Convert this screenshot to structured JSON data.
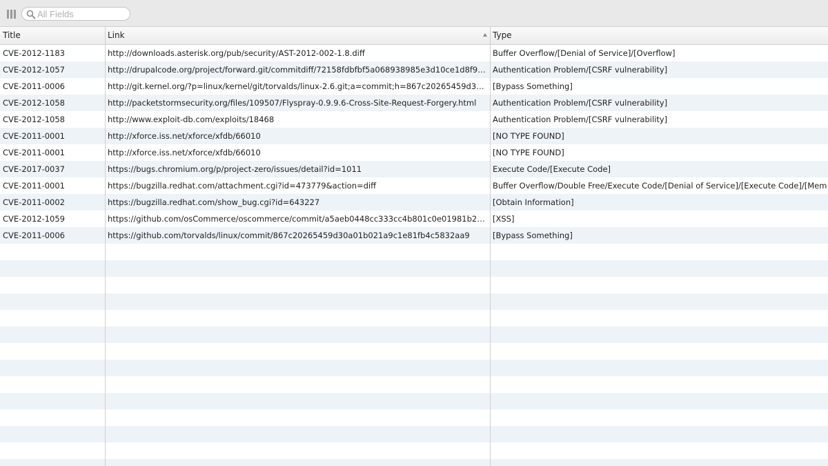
{
  "search": {
    "placeholder": "All Fields",
    "value": ""
  },
  "columns": {
    "title": "Title",
    "link": "Link",
    "type": "Type"
  },
  "rows": [
    {
      "title": "CVE-2012-1183",
      "link": "http://downloads.asterisk.org/pub/security/AST-2012-002-1.8.diff",
      "type": "Buffer Overflow/[Denial of Service]/[Overflow]"
    },
    {
      "title": "CVE-2012-1057",
      "link": "http://drupalcode.org/project/forward.git/commitdiff/72158fdbfbf5a068938985e3d10ce1d8f96...",
      "type": "Authentication Problem/[CSRF vulnerability]"
    },
    {
      "title": "CVE-2011-0006",
      "link": "http://git.kernel.org/?p=linux/kernel/git/torvalds/linux-2.6.git;a=commit;h=867c20265459d30...",
      "type": "[Bypass Something]"
    },
    {
      "title": "CVE-2012-1058",
      "link": "http://packetstormsecurity.org/files/109507/Flyspray-0.9.9.6-Cross-Site-Request-Forgery.html",
      "type": "Authentication Problem/[CSRF vulnerability]"
    },
    {
      "title": "CVE-2012-1058",
      "link": "http://www.exploit-db.com/exploits/18468",
      "type": "Authentication Problem/[CSRF vulnerability]"
    },
    {
      "title": "CVE-2011-0001",
      "link": "http://xforce.iss.net/xforce/xfdb/66010",
      "type": "[NO TYPE FOUND]"
    },
    {
      "title": "CVE-2011-0001",
      "link": "http://xforce.iss.net/xforce/xfdb/66010",
      "type": "[NO TYPE FOUND]"
    },
    {
      "title": "CVE-2017-0037",
      "link": "https://bugs.chromium.org/p/project-zero/issues/detail?id=1011",
      "type": "Execute Code/[Execute Code]"
    },
    {
      "title": "CVE-2011-0001",
      "link": "https://bugzilla.redhat.com/attachment.cgi?id=473779&action=diff",
      "type": "Buffer Overflow/Double Free/Execute Code/[Denial of Service]/[Execute Code]/[Mem"
    },
    {
      "title": "CVE-2011-0002",
      "link": "https://bugzilla.redhat.com/show_bug.cgi?id=643227",
      "type": "[Obtain Information]"
    },
    {
      "title": "CVE-2012-1059",
      "link": "https://github.com/osCommerce/oscommerce/commit/a5aeb0448cc333cc4b801c0e01981b218...",
      "type": "[XSS]"
    },
    {
      "title": "CVE-2011-0006",
      "link": "https://github.com/torvalds/linux/commit/867c20265459d30a01b021a9c1e81fb4c5832aa9",
      "type": "[Bypass Something]"
    }
  ],
  "colors": {
    "toolbar_bg": "#e9e9e9",
    "row_alt_bg": "#eef3f8"
  },
  "icons": {
    "columns": "columns-icon",
    "search": "search-icon",
    "sort": "sort-ascending-icon"
  }
}
